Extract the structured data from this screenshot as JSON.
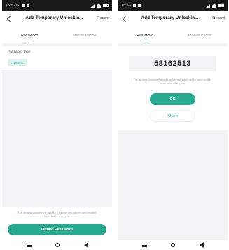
{
  "left": {
    "status": {
      "time": "15:52 G"
    },
    "header": {
      "title": "Add Temporary Unlockin...",
      "record": "Record"
    },
    "tabs": [
      {
        "label": "Password"
      },
      {
        "label": "Mobile Phone"
      }
    ],
    "password_type_label": "Password Type",
    "password_type_value": "Dynamic",
    "bottom_note": "The dynamic password is valid for 5 minutes and can be used multiple times before it expires.",
    "obtain_button": "Obtain Password"
  },
  "right": {
    "status": {
      "time": "15:53"
    },
    "header": {
      "title": "Add Temporary Unlockin...",
      "record": "Record"
    },
    "tabs": [
      {
        "label": "Password"
      },
      {
        "label": "Mobile Phone"
      }
    ],
    "password": "58162513",
    "note": "The dynamic password is valid for 5 minutes and can be used multiple times before it expires.",
    "ok_button": "OK",
    "share_button": "Share"
  },
  "icons": {
    "back": "back-chevron-icon",
    "nav_menu": "menu-icon",
    "nav_home": "home-icon",
    "nav_back": "nav-back-icon"
  },
  "colors": {
    "accent": "#26a98e",
    "chip_bg": "#def3ee",
    "gray_bg": "#f2f3f5",
    "status_bar": "#1a1a1a"
  }
}
